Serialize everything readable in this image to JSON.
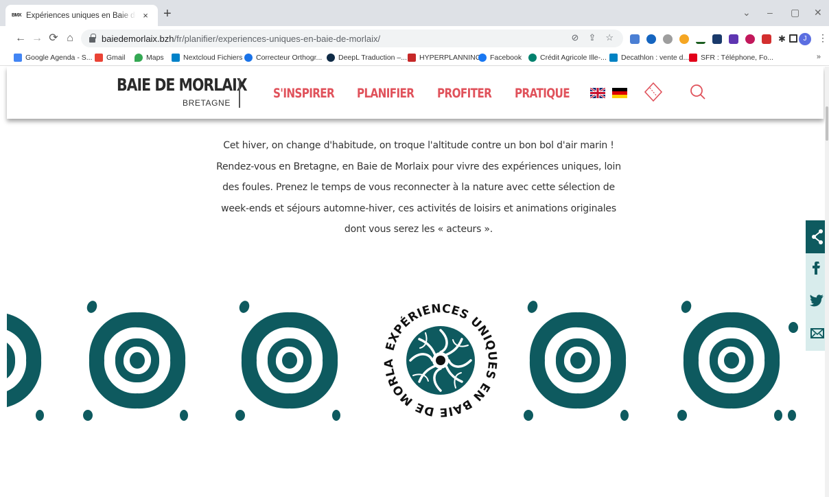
{
  "browser": {
    "tab_title": "Expériences uniques en Baie de M",
    "tab_favicon_text": "BMX",
    "new_tab": "+",
    "close_tab": "×",
    "url_host": "baiedemorlaix.bzh",
    "url_path": "/fr/planifier/experiences-uniques-en-baie-de-morlaix/",
    "profile_initial": "J",
    "window_controls": [
      "⌄",
      "–",
      "▢",
      "✕"
    ]
  },
  "bookmarks": [
    {
      "label": "Google Agenda - S...",
      "icon": "calendar-icon",
      "color": "#4285f4"
    },
    {
      "label": "Gmail",
      "icon": "gmail-icon",
      "color": "#ea4335"
    },
    {
      "label": "Maps",
      "icon": "maps-icon",
      "color": "#34a853"
    },
    {
      "label": "Nextcloud Fichiers",
      "icon": "nextcloud-icon",
      "color": "#0082c9"
    },
    {
      "label": "Correcteur Orthogr...",
      "icon": "correcteur-icon",
      "color": "#1a73e8"
    },
    {
      "label": "DeepL Traduction –...",
      "icon": "deepl-icon",
      "color": "#0f2b46"
    },
    {
      "label": "HYPERPLANNING",
      "icon": "hyperplanning-icon",
      "color": "#c62828"
    },
    {
      "label": "Facebook",
      "icon": "facebook-icon",
      "color": "#1877f2"
    },
    {
      "label": "Crédit Agricole Ille-...",
      "icon": "credit-agricole-icon",
      "color": "#00816d"
    },
    {
      "label": "Decathlon : vente d...",
      "icon": "decathlon-icon",
      "color": "#0082c3"
    },
    {
      "label": "SFR : Téléphone, Fo...",
      "icon": "sfr-icon",
      "color": "#e2001a"
    }
  ],
  "bookmarks_more": "»",
  "site": {
    "logo_main": "BAIE DE MORLAIX",
    "logo_sub": "BRETAGNE",
    "nav": [
      "S'INSPIRER",
      "PLANIFIER",
      "PROFITER",
      "PRATIQUE"
    ],
    "accent_color": "#e0525b",
    "teal_color": "#0e5a5f"
  },
  "content": {
    "intro_lines": [
      "Cet hiver, on change d'habitude, on troque l'altitude contre un bon bol d'air marin !",
      "Rendez-vous en Bretagne, en Baie de Morlaix pour vivre des expériences uniques, loin",
      "des foules. Prenez le temps de vous reconnecter à la nature avec cette sélection de",
      "week-ends et séjours automne-hiver, ces activités de loisirs et animations originales",
      "dont vous serez les « acteurs »."
    ],
    "badge_text": "EXPÉRIENCES UNIQUES EN BAIE DE MORLAIX"
  }
}
